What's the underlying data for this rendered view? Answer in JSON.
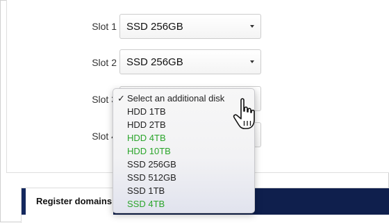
{
  "slots": [
    {
      "label": "Slot 1",
      "value": "SSD 256GB"
    },
    {
      "label": "Slot 2",
      "value": "SSD 256GB"
    },
    {
      "label": "Slot 3",
      "value": ""
    },
    {
      "label": "Slot 4",
      "value": ""
    }
  ],
  "dropdown": {
    "selected_marker": "✓",
    "options": [
      {
        "label": "Select an additional disk",
        "selected": true,
        "color": "#222222"
      },
      {
        "label": "HDD 1TB",
        "color": "#222222"
      },
      {
        "label": "HDD 2TB",
        "color": "#222222"
      },
      {
        "label": "HDD 4TB",
        "color": "#2aa52a"
      },
      {
        "label": "HDD 10TB",
        "color": "#2aa52a"
      },
      {
        "label": "SSD 256GB",
        "color": "#222222"
      },
      {
        "label": "SSD 512GB",
        "color": "#222222"
      },
      {
        "label": "SSD 1TB",
        "color": "#222222"
      },
      {
        "label": "SSD 4TB",
        "color": "#2aa52a"
      }
    ]
  },
  "section": {
    "title": "Register domains"
  },
  "colors": {
    "available_highlight": "#2aa52a",
    "section_bar": "#0f1f4d"
  },
  "cursor": "hand-pointer-icon"
}
